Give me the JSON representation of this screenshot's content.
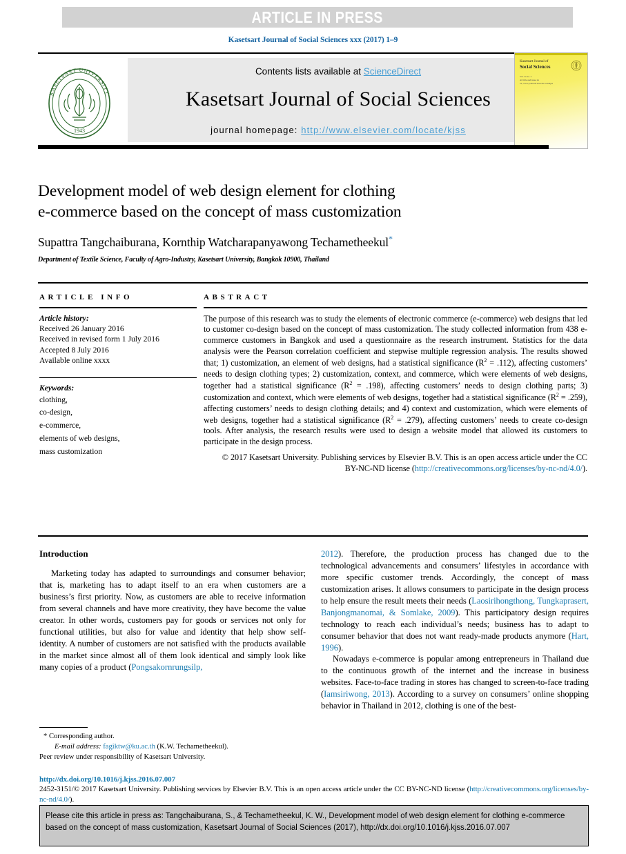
{
  "banner": {
    "label": "ARTICLE IN PRESS"
  },
  "running_head": "Kasetsart Journal of Social Sciences xxx (2017) 1–9",
  "masthead": {
    "contents_prefix": "Contents lists available at ",
    "sciencedirect": "ScienceDirect",
    "journal_title": "Kasetsart Journal of Social Sciences",
    "homepage_label": "journal homepage: ",
    "homepage_url": "http://www.elsevier.com/locate/kjss",
    "logo_alt": "Kasetsart University seal",
    "logo_ring_text": "KASETSART UNIVERSITY",
    "logo_year": "1943",
    "cover": {
      "line1": "Kasetsart Journal of",
      "line2": "Social Sciences",
      "sub": "Vol. xx no. x\nAll title and issue xx\nxx, www.journals.elsevier.com/kjss"
    }
  },
  "article": {
    "title_line1": "Development model of web design element for clothing",
    "title_line2": "e-commerce based on the concept of mass customization",
    "authors": "Supattra Tangchaiburana, Kornthip Watcharapanyawong Techametheekul",
    "corresponding_marker": "*",
    "affiliation": "Department of Textile Science, Faculty of Agro-Industry, Kasetsart University, Bangkok 10900, Thailand"
  },
  "article_info": {
    "heading": "ARTICLE INFO",
    "history_label": "Article history:",
    "history": [
      "Received 26 January 2016",
      "Received in revised form 1 July 2016",
      "Accepted 8 July 2016",
      "Available online xxxx"
    ],
    "keywords_label": "Keywords:",
    "keywords": [
      "clothing,",
      "co-design,",
      "e-commerce,",
      "elements of web designs,",
      "mass customization"
    ]
  },
  "abstract": {
    "heading": "ABSTRACT",
    "body_part1": "The purpose of this research was to study the elements of electronic commerce (e-commerce) web designs that led to customer co-design based on the concept of mass customization. The study collected information from 438 e-commerce customers in Bangkok and used a questionnaire as the research instrument. Statistics for the data analysis were the Pearson correlation coefficient and stepwise multiple regression analysis. The results showed that; 1) customization, an element of web designs, had a statistical significance (R",
    "sup1": "2",
    "body_part2": " = .112), affecting customers’ needs to design clothing types; 2) customization, context, and commerce, which were elements of web designs, together had a statistical significance (R",
    "sup2": "2",
    "body_part3": " = .198), affecting customers’ needs to design clothing parts; 3) customization and context, which were elements of web designs, together had a statistical significance (R",
    "sup3": "2",
    "body_part4": " = .259), affecting customers’ needs to design clothing details; and 4) context and customization, which were elements of web designs, together had a statistical significance (R",
    "sup4": "2",
    "body_part5": " = .279), affecting customers’ needs to create co-design tools. After analysis, the research results were used to design a website model that allowed its customers to participate in the design process.",
    "copyright_line1": "© 2017 Kasetsart University. Publishing services by Elsevier B.V. This is an open access article under the CC BY-NC-ND license (",
    "license_url": "http://creativecommons.org/licenses/by-nc-nd/4.0/",
    "copyright_tail": ")."
  },
  "introduction": {
    "heading": "Introduction",
    "left_para1": "Marketing today has adapted to surroundings and consumer behavior; that is, marketing has to adapt itself to an era when customers are a business’s first priority. Now, as customers are able to receive information from several channels and have more creativity, they have become the value creator. In other words, customers pay for goods or services not only for functional utilities, but also for value and identity that help show self-identity. A number of customers are not satisfied with the products available in the market since almost all of them look identical and simply look like many copies of a product (",
    "left_cite1": "Pongsakornrungsilp,",
    "right_cite_year": "2012",
    "right_para1_a": "). Therefore, the production process has changed due to the technological advancements and consumers’ lifestyles in accordance with more specific customer trends. Accordingly, the concept of mass customization arises. It allows consumers to participate in the design process to help ensure the result meets their needs (",
    "right_cite2": "Laosirihongthong, Tungkaprasert, Banjongmanomai, & Somlake, 2009",
    "right_para1_b": "). This participatory design requires technology to reach each individual’s needs; business has to adapt to consumer behavior that does not want ready-made products anymore (",
    "right_cite3": "Hart, 1996",
    "right_para1_c": ").",
    "right_para2_a": "Nowadays e-commerce is popular among entrepreneurs in Thailand due to the continuous growth of the internet and the increase in business websites. Face-to-face trading in stores has changed to screen-to-face trading (",
    "right_cite4": "Iamsiriwong, 2013",
    "right_para2_b": "). According to a survey on consumers’ online shopping behavior in Thailand in 2012, clothing is one of the best-"
  },
  "footnote": {
    "corresponding": "* Corresponding author.",
    "email_label": "E-mail address:",
    "email": "fagiktw@ku.ac.th",
    "email_tail": "(K.W. Techametheekul).",
    "peer_review": "Peer review under responsibility of Kasetsart University."
  },
  "footer": {
    "doi": "http://dx.doi.org/10.1016/j.kjss.2016.07.007",
    "issn_part1": "2452-3151/© 2017 Kasetsart University. Publishing services by Elsevier B.V. This is an open access article under the CC BY-NC-ND license (",
    "issn_link": "http://creativecommons.org/licenses/by-nc-nd/4.0/",
    "issn_tail": ")."
  },
  "cite_box": {
    "text": "Please cite this article in press as: Tangchaiburana, S., & Techametheekul, K. W., Development model of web design element for clothing e-commerce based on the concept of mass customization, Kasetsart Journal of Social Sciences (2017), http://dx.doi.org/10.1016/j.kjss.2016.07.007"
  },
  "colors": {
    "link": "#1a7bb0",
    "banner_bg": "#d2d2d2",
    "masthead_bg": "#e9e9e9",
    "cite_box_bg": "#c8c8c8",
    "seal_green": "#2e6b2e",
    "cover_yellow": "#f5ec4a"
  }
}
